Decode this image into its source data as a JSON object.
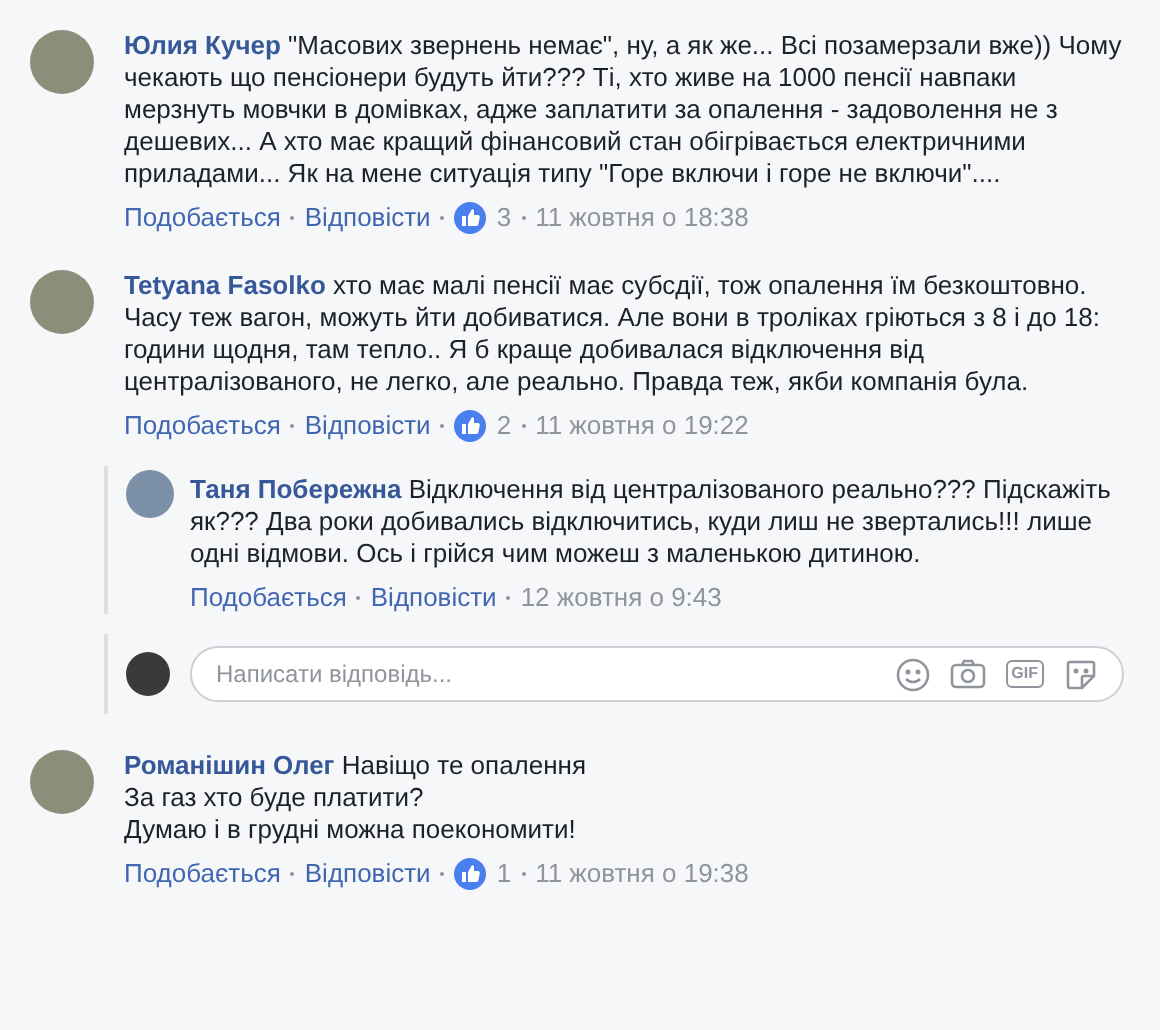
{
  "comments": [
    {
      "author": "Юлия Кучер",
      "text": "\"Масових звернень немає\", ну, а як же... Всі позамерзали вже)) Чому чекають що пенсіонери будуть йти??? Ті, хто живе на 1000 пенсії навпаки мерзнуть мовчки в домівках, адже заплатити за опалення - задоволення не з дешевих... А хто має кращий фінансовий стан обігрівається електричними приладами... Як на мене ситуація типу \"Горе включи і горе не включи\"....",
      "like": "Подобається",
      "reply": "Відповісти",
      "likes": "3",
      "time": "11 жовтня о 18:38"
    },
    {
      "author": "Tetyana Fasolko",
      "text": "хто має малі пенсії має субсдії, тож опалення їм безкоштовно. Часу теж вагон, можуть йти добиватися. Але вони в троліках гріються з 8 і до 18: години щодня, там тепло.. Я б краще добивалася відключення від централізованого, не легко, але реально. Правда теж, якби компанія була.",
      "like": "Подобається",
      "reply": "Відповісти",
      "likes": "2",
      "time": "11 жовтня о 19:22",
      "replies": [
        {
          "author": "Таня Побережна",
          "text": "Відключення від централізованого реально??? Підскажіть як??? Два роки добивались відключитись, куди лиш не звертались!!! лише одні відмови. Ось і грійся чим можеш з маленькою дитиною.",
          "like": "Подобається",
          "reply": "Відповісти",
          "time": "12 жовтня о 9:43"
        }
      ],
      "reply_box": {
        "placeholder": "Написати відповідь...",
        "gif_label": "GIF"
      }
    },
    {
      "author": "Романішин Олег",
      "text": "Навіщо те опалення\nЗа газ хто буде платити?\nДумаю і в грудні можна поекономити!",
      "like": "Подобається",
      "reply": "Відповісти",
      "likes": "1",
      "time": "11 жовтня о 19:38"
    }
  ]
}
